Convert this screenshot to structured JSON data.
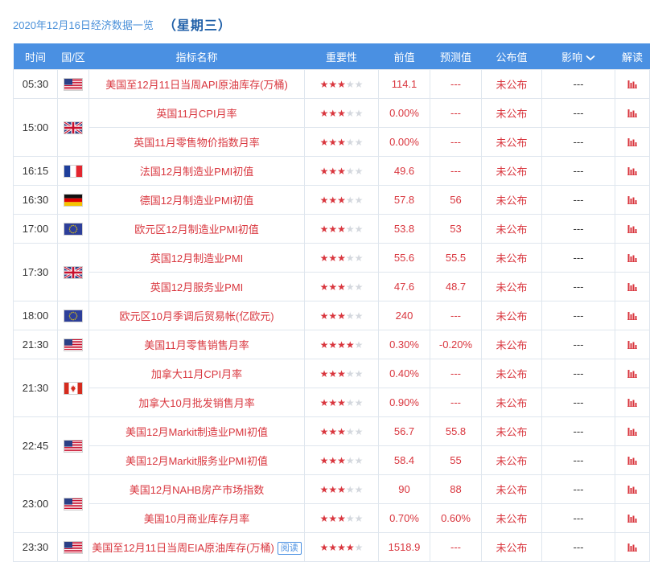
{
  "page": {
    "date_title": "2020年12月16日经济数据一览",
    "weekday": "（星期三）"
  },
  "table": {
    "headers": {
      "time": "时间",
      "region": "国/区",
      "indicator": "指标名称",
      "importance": "重要性",
      "previous": "前值",
      "forecast": "预测值",
      "actual": "公布值",
      "impact": "影响",
      "interpret": "解读"
    },
    "groups": [
      {
        "time": "05:30",
        "flag": "us",
        "rows": [
          {
            "name": "美国至12月11日当周API原油库存(万桶)",
            "stars": 3,
            "prev": "114.1",
            "fc": "---",
            "act": "未公布",
            "inf": "---"
          }
        ]
      },
      {
        "time": "15:00",
        "flag": "uk",
        "rows": [
          {
            "name": "英国11月CPI月率",
            "stars": 3,
            "prev": "0.00%",
            "fc": "---",
            "act": "未公布",
            "inf": "---"
          },
          {
            "name": "英国11月零售物价指数月率",
            "stars": 3,
            "prev": "0.00%",
            "fc": "---",
            "act": "未公布",
            "inf": "---"
          }
        ]
      },
      {
        "time": "16:15",
        "flag": "fr",
        "rows": [
          {
            "name": "法国12月制造业PMI初值",
            "stars": 3,
            "prev": "49.6",
            "fc": "---",
            "act": "未公布",
            "inf": "---"
          }
        ]
      },
      {
        "time": "16:30",
        "flag": "de",
        "rows": [
          {
            "name": "德国12月制造业PMI初值",
            "stars": 3,
            "prev": "57.8",
            "fc": "56",
            "act": "未公布",
            "inf": "---"
          }
        ]
      },
      {
        "time": "17:00",
        "flag": "eu",
        "rows": [
          {
            "name": "欧元区12月制造业PMI初值",
            "stars": 3,
            "prev": "53.8",
            "fc": "53",
            "act": "未公布",
            "inf": "---"
          }
        ]
      },
      {
        "time": "17:30",
        "flag": "uk",
        "rows": [
          {
            "name": "英国12月制造业PMI",
            "stars": 3,
            "prev": "55.6",
            "fc": "55.5",
            "act": "未公布",
            "inf": "---"
          },
          {
            "name": "英国12月服务业PMI",
            "stars": 3,
            "prev": "47.6",
            "fc": "48.7",
            "act": "未公布",
            "inf": "---"
          }
        ]
      },
      {
        "time": "18:00",
        "flag": "eu",
        "rows": [
          {
            "name": "欧元区10月季调后贸易帐(亿欧元)",
            "stars": 3,
            "prev": "240",
            "fc": "---",
            "act": "未公布",
            "inf": "---"
          }
        ]
      },
      {
        "time": "21:30",
        "flag": "us",
        "rows": [
          {
            "name": "美国11月零售销售月率",
            "stars": 4,
            "prev": "0.30%",
            "fc": "-0.20%",
            "act": "未公布",
            "inf": "---"
          }
        ]
      },
      {
        "time": "21:30",
        "flag": "ca",
        "rows": [
          {
            "name": "加拿大11月CPI月率",
            "stars": 3,
            "prev": "0.40%",
            "fc": "---",
            "act": "未公布",
            "inf": "---"
          },
          {
            "name": "加拿大10月批发销售月率",
            "stars": 3,
            "prev": "0.90%",
            "fc": "---",
            "act": "未公布",
            "inf": "---"
          }
        ]
      },
      {
        "time": "22:45",
        "flag": "us",
        "rows": [
          {
            "name": "美国12月Markit制造业PMI初值",
            "stars": 3,
            "prev": "56.7",
            "fc": "55.8",
            "act": "未公布",
            "inf": "---"
          },
          {
            "name": "美国12月Markit服务业PMI初值",
            "stars": 3,
            "prev": "58.4",
            "fc": "55",
            "act": "未公布",
            "inf": "---"
          }
        ]
      },
      {
        "time": "23:00",
        "flag": "us",
        "rows": [
          {
            "name": "美国12月NAHB房产市场指数",
            "stars": 3,
            "prev": "90",
            "fc": "88",
            "act": "未公布",
            "inf": "---"
          },
          {
            "name": "美国10月商业库存月率",
            "stars": 3,
            "prev": "0.70%",
            "fc": "0.60%",
            "act": "未公布",
            "inf": "---"
          }
        ]
      },
      {
        "time": "23:30",
        "flag": "us",
        "rows": [
          {
            "name": "美国至12月11日当周EIA原油库存(万桶)",
            "tag": "阅读",
            "stars": 4,
            "prev": "1518.9",
            "fc": "---",
            "act": "未公布",
            "inf": "---"
          }
        ]
      }
    ]
  },
  "colors": {
    "header_bg": "#4a90e2",
    "value_red": "#d9363e",
    "title_blue": "#4a90d9"
  },
  "icons": {
    "impact_caret": "chevron-down-icon",
    "interpret": "bar-chart-icon",
    "importance": "star-icon"
  }
}
